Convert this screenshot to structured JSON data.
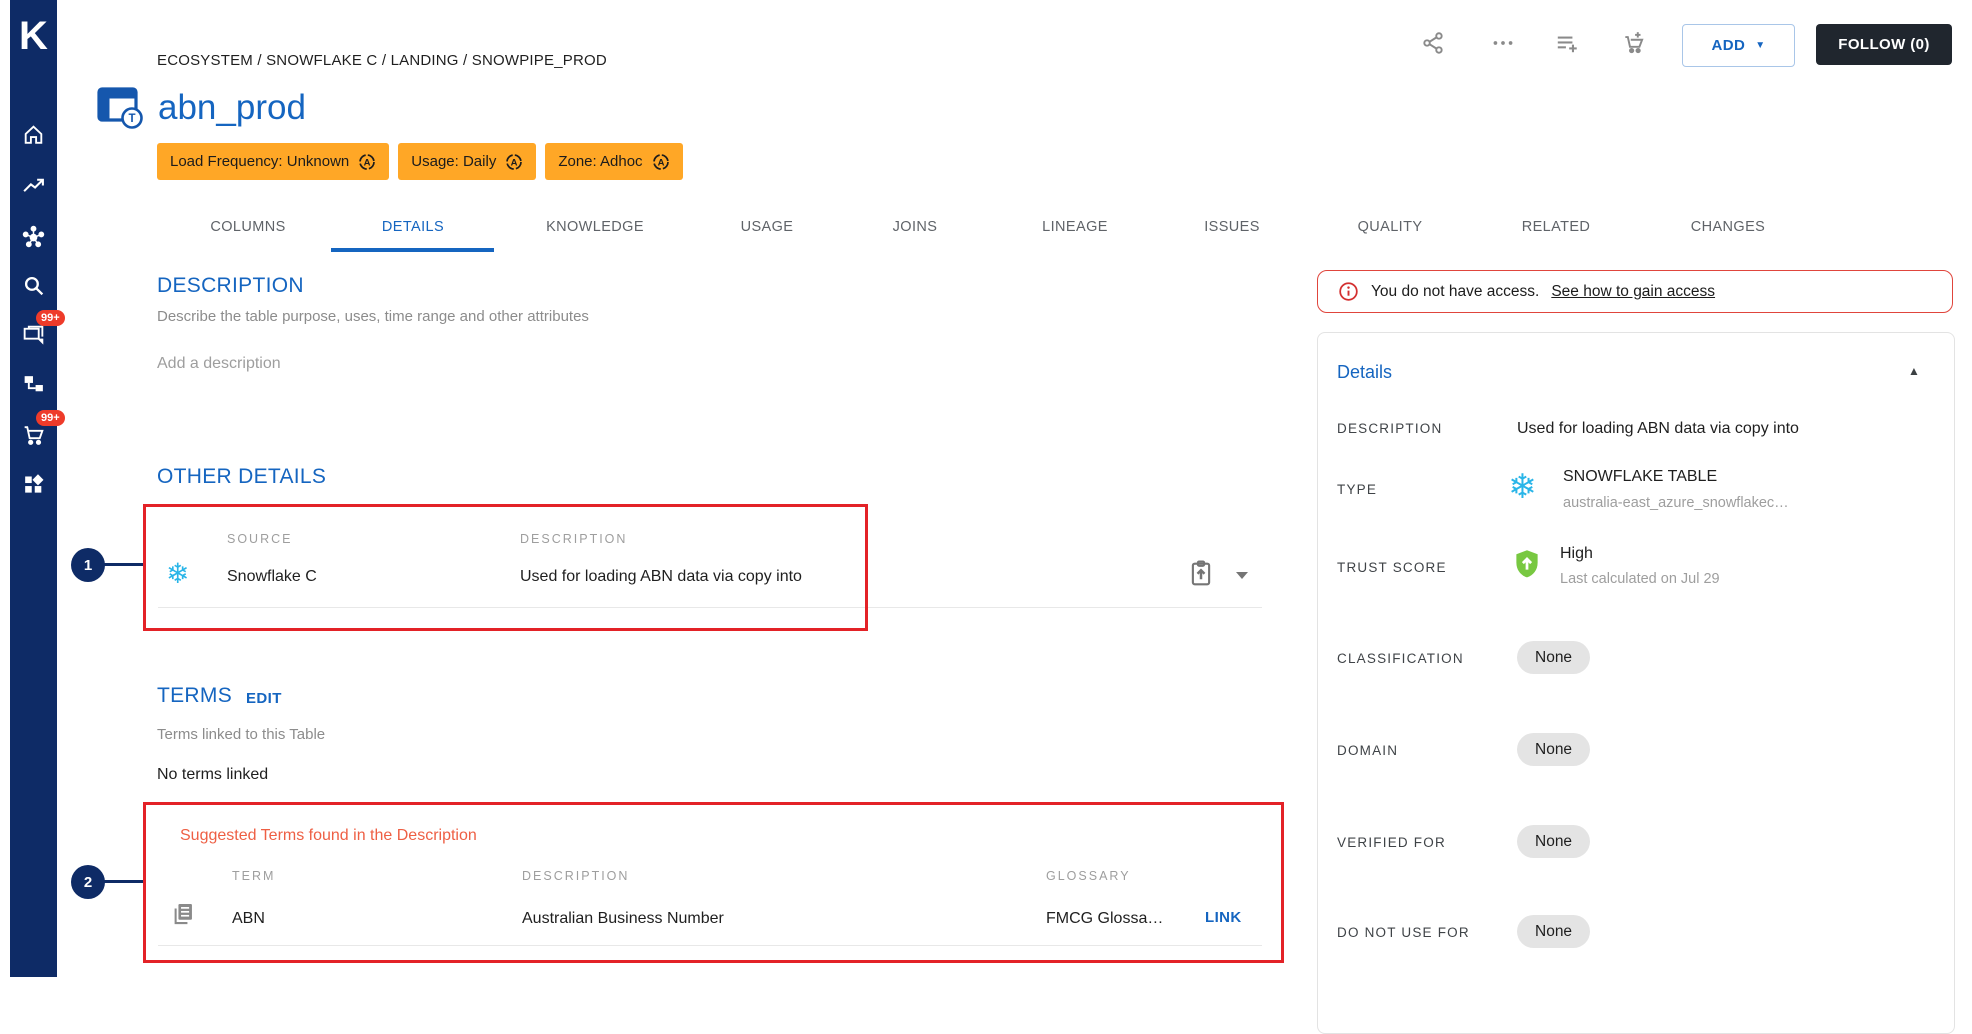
{
  "app": {
    "logo_letter": "K"
  },
  "sidebar": {
    "chat_badge": "99+",
    "cart_badge": "99+"
  },
  "toolbar": {
    "add_label": "ADD",
    "follow_label": "FOLLOW (0)"
  },
  "header": {
    "breadcrumb": "ECOSYSTEM / SNOWFLAKE C / LANDING / SNOWPIPE_PROD",
    "title": "abn_prod"
  },
  "tags": [
    {
      "label": "Load Frequency: Unknown"
    },
    {
      "label": "Usage: Daily"
    },
    {
      "label": "Zone: Adhoc"
    }
  ],
  "tabs": [
    {
      "label": "COLUMNS"
    },
    {
      "label": "DETAILS",
      "active": true
    },
    {
      "label": "KNOWLEDGE"
    },
    {
      "label": "USAGE"
    },
    {
      "label": "JOINS"
    },
    {
      "label": "LINEAGE"
    },
    {
      "label": "ISSUES"
    },
    {
      "label": "QUALITY"
    },
    {
      "label": "RELATED"
    },
    {
      "label": "CHANGES"
    }
  ],
  "description_section": {
    "heading": "DESCRIPTION",
    "subtitle": "Describe the table purpose, uses, time range and other attributes",
    "placeholder": "Add a description"
  },
  "other_details": {
    "heading": "OTHER DETAILS",
    "col_source": "SOURCE",
    "col_description": "DESCRIPTION",
    "row": {
      "source": "Snowflake C",
      "description": "Used for loading ABN data via copy into"
    }
  },
  "terms": {
    "heading": "TERMS",
    "edit_label": "EDIT",
    "subtitle": "Terms linked to this Table",
    "empty_text": "No terms linked"
  },
  "suggested_terms": {
    "title": "Suggested Terms found in the Description",
    "col_term": "TERM",
    "col_description": "DESCRIPTION",
    "col_glossary": "GLOSSARY",
    "row": {
      "term": "ABN",
      "description": "Australian Business Number",
      "glossary": "FMCG Glossa…",
      "action": "LINK"
    }
  },
  "access_banner": {
    "text": "You do not have access.",
    "link_text": "See how to gain access"
  },
  "details_panel": {
    "heading": "Details",
    "description": {
      "label": "DESCRIPTION",
      "value": "Used for loading ABN data via copy into"
    },
    "type": {
      "label": "TYPE",
      "value": "SNOWFLAKE TABLE",
      "sub": "australia-east_azure_snowflakec…"
    },
    "trust_score": {
      "label": "TRUST SCORE",
      "value": "High",
      "sub": "Last calculated on Jul 29"
    },
    "classification": {
      "label": "CLASSIFICATION",
      "value": "None"
    },
    "domain": {
      "label": "DOMAIN",
      "value": "None"
    },
    "verified_for": {
      "label": "VERIFIED FOR",
      "value": "None"
    },
    "do_not_use_for": {
      "label": "DO NOT USE FOR",
      "value": "None"
    }
  },
  "annotations": {
    "step1": "1",
    "step2": "2"
  },
  "colors": {
    "primary_blue": "#1565c0",
    "navy": "#0e2b66",
    "tag_orange": "#ffa726",
    "annotation_red": "#e32227",
    "suggestion_orange": "#ee5f44",
    "snowflake_cyan": "#29b5e8",
    "trust_green": "#78c841",
    "badge_red": "#ee3b2a",
    "follow_dark": "#20262e"
  }
}
